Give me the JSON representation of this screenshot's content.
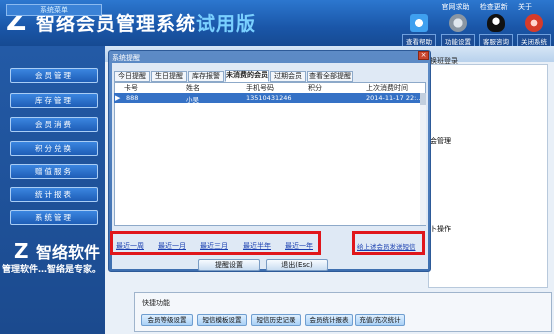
{
  "header": {
    "app_title": "智络会员管理系统",
    "trial_label": "试用版",
    "top_links": [
      "官网求助",
      "检查更新",
      "关于"
    ],
    "tools": [
      {
        "label": "查看帮助",
        "icon": "help-icon"
      },
      {
        "label": "功能设置",
        "icon": "settings-icon"
      },
      {
        "label": "客服咨询",
        "icon": "qq-icon"
      },
      {
        "label": "关闭系统",
        "icon": "power-icon"
      }
    ],
    "colors": {
      "header": "#1a56a8",
      "trial": "#7ad0ff"
    }
  },
  "sidebar": {
    "section_title": "系统菜单",
    "items": [
      "会员管理",
      "库存管理",
      "会员消费",
      "积分兑换",
      "赠值服务",
      "统计报表",
      "系统管理"
    ],
    "brand": "智络软件",
    "slogan": "管理软件…智络是专家。"
  },
  "main": {
    "shift_label": "换班登录",
    "note_member": "会管理",
    "note_ops": "卜操作",
    "quick_title": "快捷功能",
    "quick_buttons": [
      "会员等级设置",
      "短信模板设置",
      "短信历史记录",
      "会员统计报表",
      "充值/充次统计"
    ]
  },
  "dialog": {
    "title": "系统提醒",
    "close": "×",
    "tabs": [
      "今日提醒",
      "生日提醒",
      "库存报警",
      "未消费的会员",
      "过期会员",
      "查看全部提醒"
    ],
    "active_tab": "未消费的会员",
    "columns": [
      "卡号",
      "姓名",
      "手机号码",
      "积分",
      "上次消费时间"
    ],
    "rows": [
      {
        "card": "888",
        "name": "小吴",
        "phone": "13510431246",
        "points": "",
        "last_time": "2014-11-17 22:..."
      }
    ],
    "range_links": [
      "最近一周",
      "最近一月",
      "最近三月",
      "最近半年",
      "最近一年"
    ],
    "send_link": "给上述会员发送短信",
    "buttons": [
      "提醒设置",
      "退出(Esc)"
    ]
  }
}
